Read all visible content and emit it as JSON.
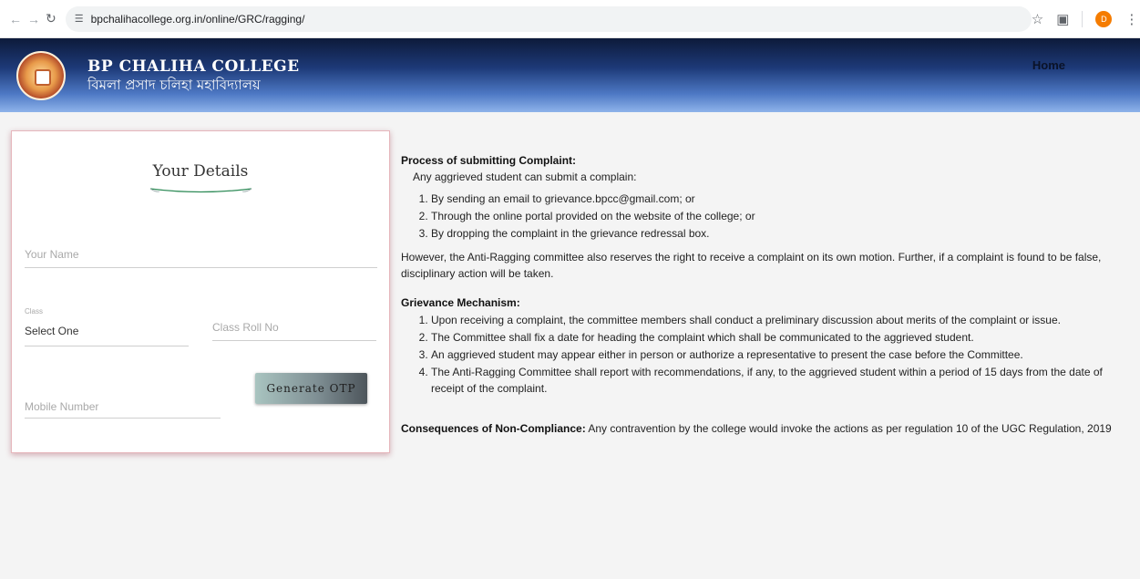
{
  "browser": {
    "url": "bpchalihacollege.org.in/online/GRC/ragging/",
    "profile_initial": "D"
  },
  "header": {
    "college_name_en": "BP CHALIHA COLLEGE",
    "college_name_bn": "বিমলা প্ৰসাদ চলিহা মহাবিদ্যালয়",
    "home_link": "Home"
  },
  "form": {
    "title": "Your Details",
    "name_placeholder": "Your Name",
    "class_label": "Class",
    "class_value": "Select One",
    "roll_placeholder": "Class Roll No",
    "mobile_placeholder": "Mobile Number",
    "otp_button": "Generate OTP"
  },
  "content": {
    "process_heading": "Process of submitting Complaint:",
    "process_intro": "Any aggrieved student can submit a complain:",
    "process_steps": [
      "By sending an email to grievance.bpcc@gmail.com; or",
      "Through the online portal provided on the website of the college; or",
      "By dropping the complaint in the grievance redressal box."
    ],
    "however_text": "However, the Anti-Ragging committee also reserves the right to receive a complaint on its own motion. Further, if a complaint is found to be false, disciplinary action will be taken.",
    "mechanism_heading": "Grievance Mechanism:",
    "mechanism_steps": [
      "Upon receiving a complaint, the committee members shall conduct a preliminary discussion about merits of the complaint or issue.",
      "The Committee shall fix a date for heading the complaint which shall be communicated to the aggrieved student.",
      "An aggrieved student may appear either in person or authorize a representative to present the case before the Committee.",
      "The Anti-Ragging Committee shall report with recommendations, if any, to the aggrieved student within a period of 15 days from the date of receipt of the complaint."
    ],
    "consequences_heading": "Consequences of Non-Compliance:",
    "consequences_text": " Any contravention by the college would invoke the actions as per regulation 10 of the UGC Regulation, 2019"
  },
  "icons": {
    "back": "arrow-left-icon",
    "forward": "arrow-right-icon",
    "reload": "reload-icon",
    "site_info": "tune-icon",
    "bookmark": "star-icon",
    "extensions": "puzzle-icon",
    "menu": "kebab-menu-icon"
  },
  "colors": {
    "header_dark": "#0d1a3a",
    "header_light": "#8eb3ea",
    "card_border": "#e6b6bc",
    "swoosh": "#2e8b57"
  }
}
